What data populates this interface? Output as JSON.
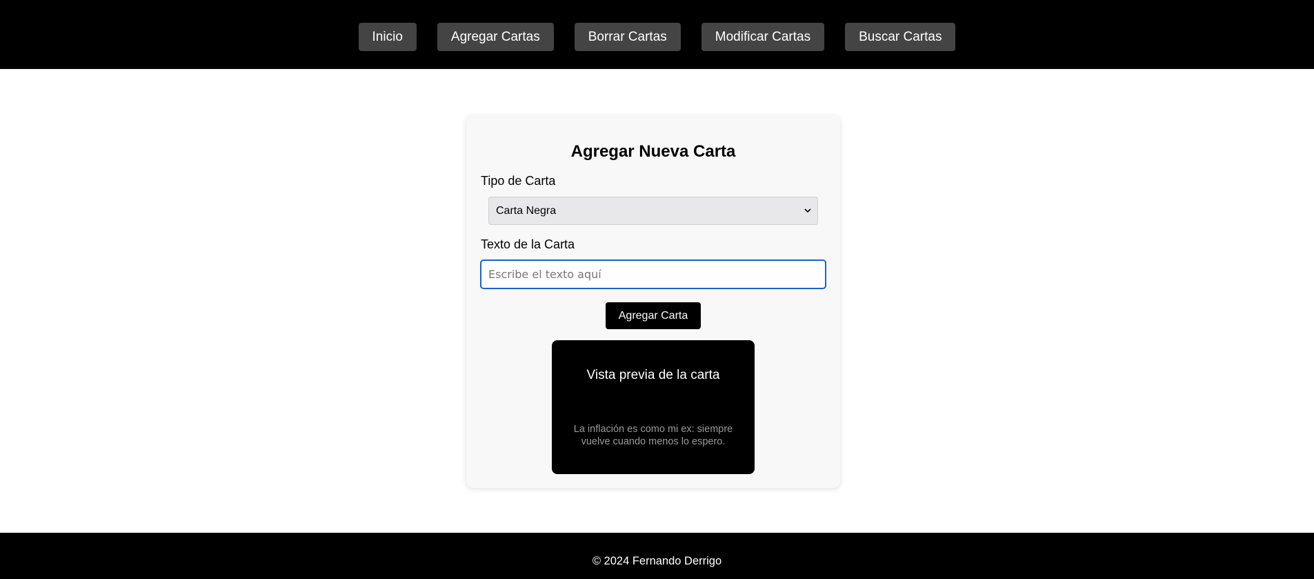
{
  "nav": {
    "items": [
      {
        "label": "Inicio"
      },
      {
        "label": "Agregar Cartas"
      },
      {
        "label": "Borrar Cartas"
      },
      {
        "label": "Modificar Cartas"
      },
      {
        "label": "Buscar Cartas"
      }
    ]
  },
  "form": {
    "title": "Agregar Nueva Carta",
    "type_label": "Tipo de Carta",
    "type_selected": "Carta Negra",
    "text_label": "Texto de la Carta",
    "text_value": "",
    "text_placeholder": "Escribe el texto aquí",
    "submit_label": "Agregar Carta"
  },
  "preview": {
    "title": "Vista previa de la carta",
    "text": "La inflación es como mi ex: siempre vuelve cuando menos lo espero."
  },
  "footer": {
    "text": "© 2024 Fernando Derrigo"
  },
  "colors": {
    "header_bg": "#000000",
    "nav_button_bg": "#444444",
    "panel_bg": "#f8f8f8",
    "input_focus": "#1a62c9",
    "card_bg": "#000000"
  }
}
